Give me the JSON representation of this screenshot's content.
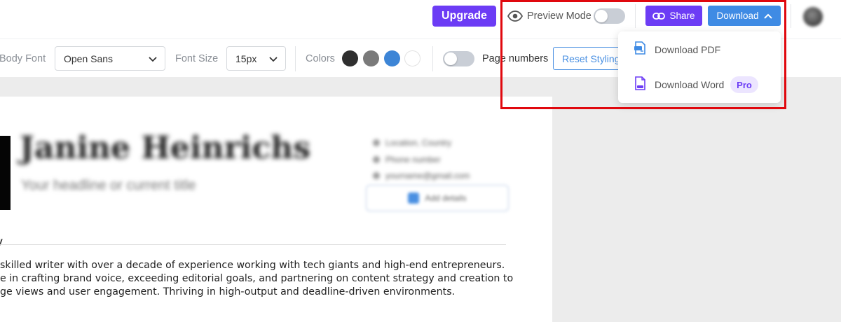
{
  "header": {
    "upgrade_label": "Upgrade",
    "preview_mode_label": "Preview Mode",
    "preview_mode_on": false,
    "share_label": "Share",
    "download_label": "Download"
  },
  "toolbar": {
    "body_font_label": "Body Font",
    "body_font_value": "Open Sans",
    "font_size_label": "Font Size",
    "font_size_value": "15px",
    "colors_label": "Colors",
    "colors": [
      "#2f2f2f",
      "#7a7a7a",
      "#3d85d6",
      "#ffffff"
    ],
    "page_numbers_label": "Page numbers",
    "page_numbers_on": false,
    "reset_styling_label": "Reset Styling"
  },
  "download_menu": {
    "items": [
      {
        "label": "Download PDF",
        "icon": "pdf-file-icon"
      },
      {
        "label": "Download Word",
        "icon": "word-file-icon",
        "badge": "Pro"
      }
    ]
  },
  "resume": {
    "name": "Janine Heinrichs",
    "headline": "Your headline or current title",
    "contact": [
      "Location, Country",
      "Phone number",
      "yourname@gmail.com"
    ],
    "add_details_label": "Add details",
    "section_heading_fragment": "y",
    "summary_lines": [
      " skilled writer with over a decade of experience working with tech giants and high-end entrepreneurs.",
      "e in crafting brand voice, exceeding editorial goals, and partnering on content strategy and creation to",
      "ge views and user engagement. Thriving in high-output and deadline-driven environments."
    ]
  }
}
